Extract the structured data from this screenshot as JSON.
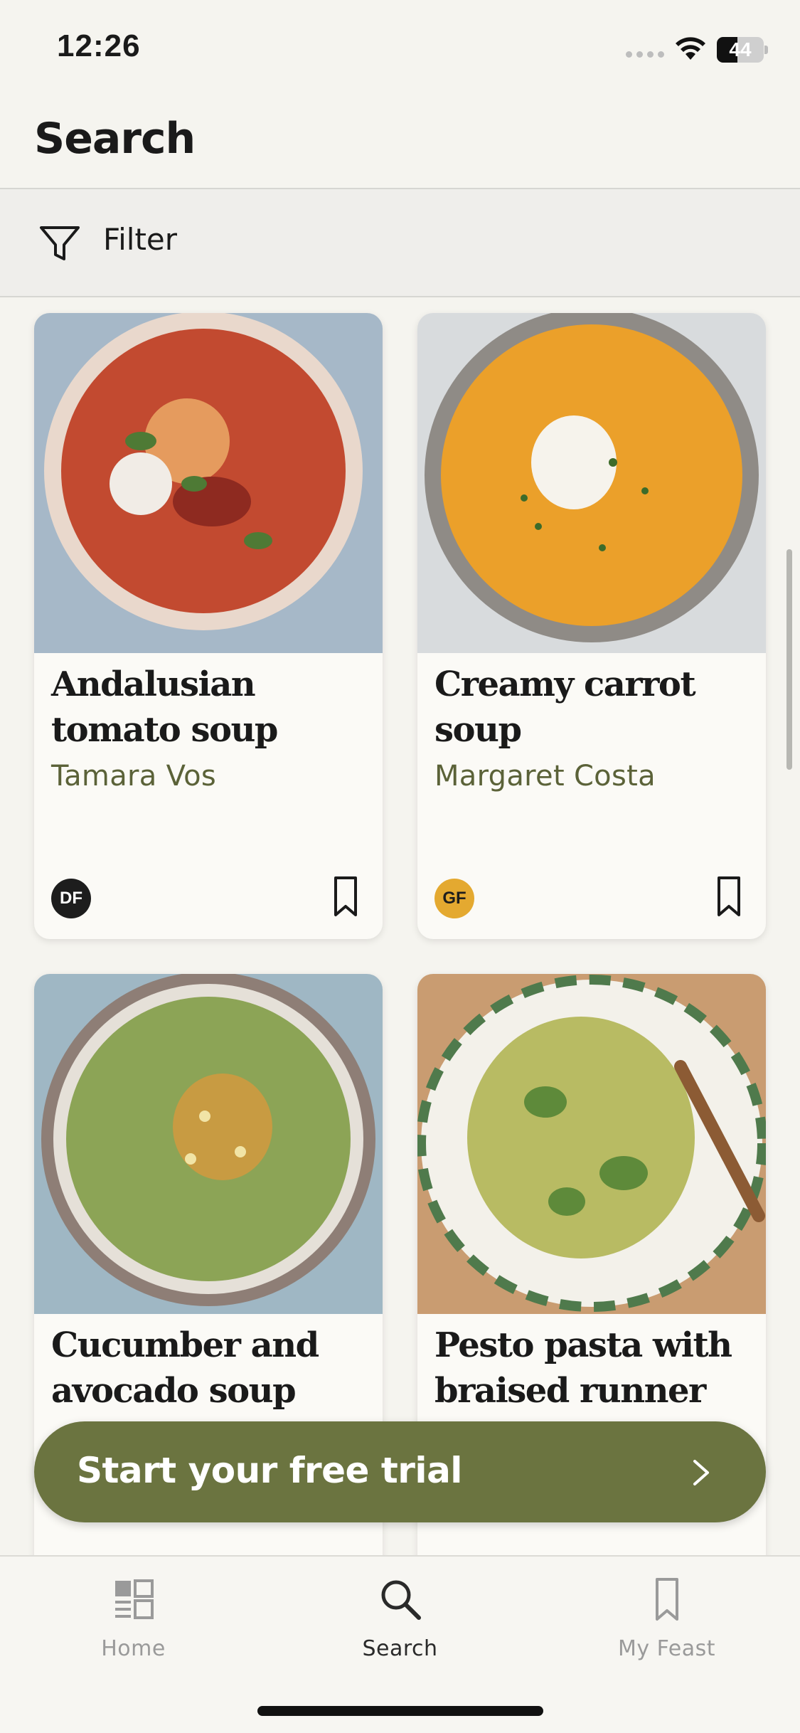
{
  "status_bar": {
    "time": "12:26",
    "battery_level": "44"
  },
  "header": {
    "title": "Search"
  },
  "filter": {
    "label": "Filter"
  },
  "recipes": [
    {
      "title": "Andalusian tomato soup",
      "author": "Tamara Vos",
      "badge": "DF"
    },
    {
      "title": "Creamy carrot soup",
      "author": "Margaret Costa",
      "badge": "GF"
    },
    {
      "title": "Cucumber and avocado soup",
      "author": "",
      "badge": ""
    },
    {
      "title": "Pesto pasta with braised runner",
      "author": "",
      "badge": ""
    }
  ],
  "trial_banner": {
    "label": "Start your free trial"
  },
  "tabs": [
    {
      "label": "Home",
      "icon": "home-grid-icon",
      "active": false
    },
    {
      "label": "Search",
      "icon": "search-icon",
      "active": true
    },
    {
      "label": "My Feast",
      "icon": "bookmark-icon",
      "active": false
    }
  ],
  "colors": {
    "accent": "#6b7440",
    "author_text": "#5b6238",
    "gf_badge": "#e4a930",
    "df_badge": "#1d1d1d"
  }
}
